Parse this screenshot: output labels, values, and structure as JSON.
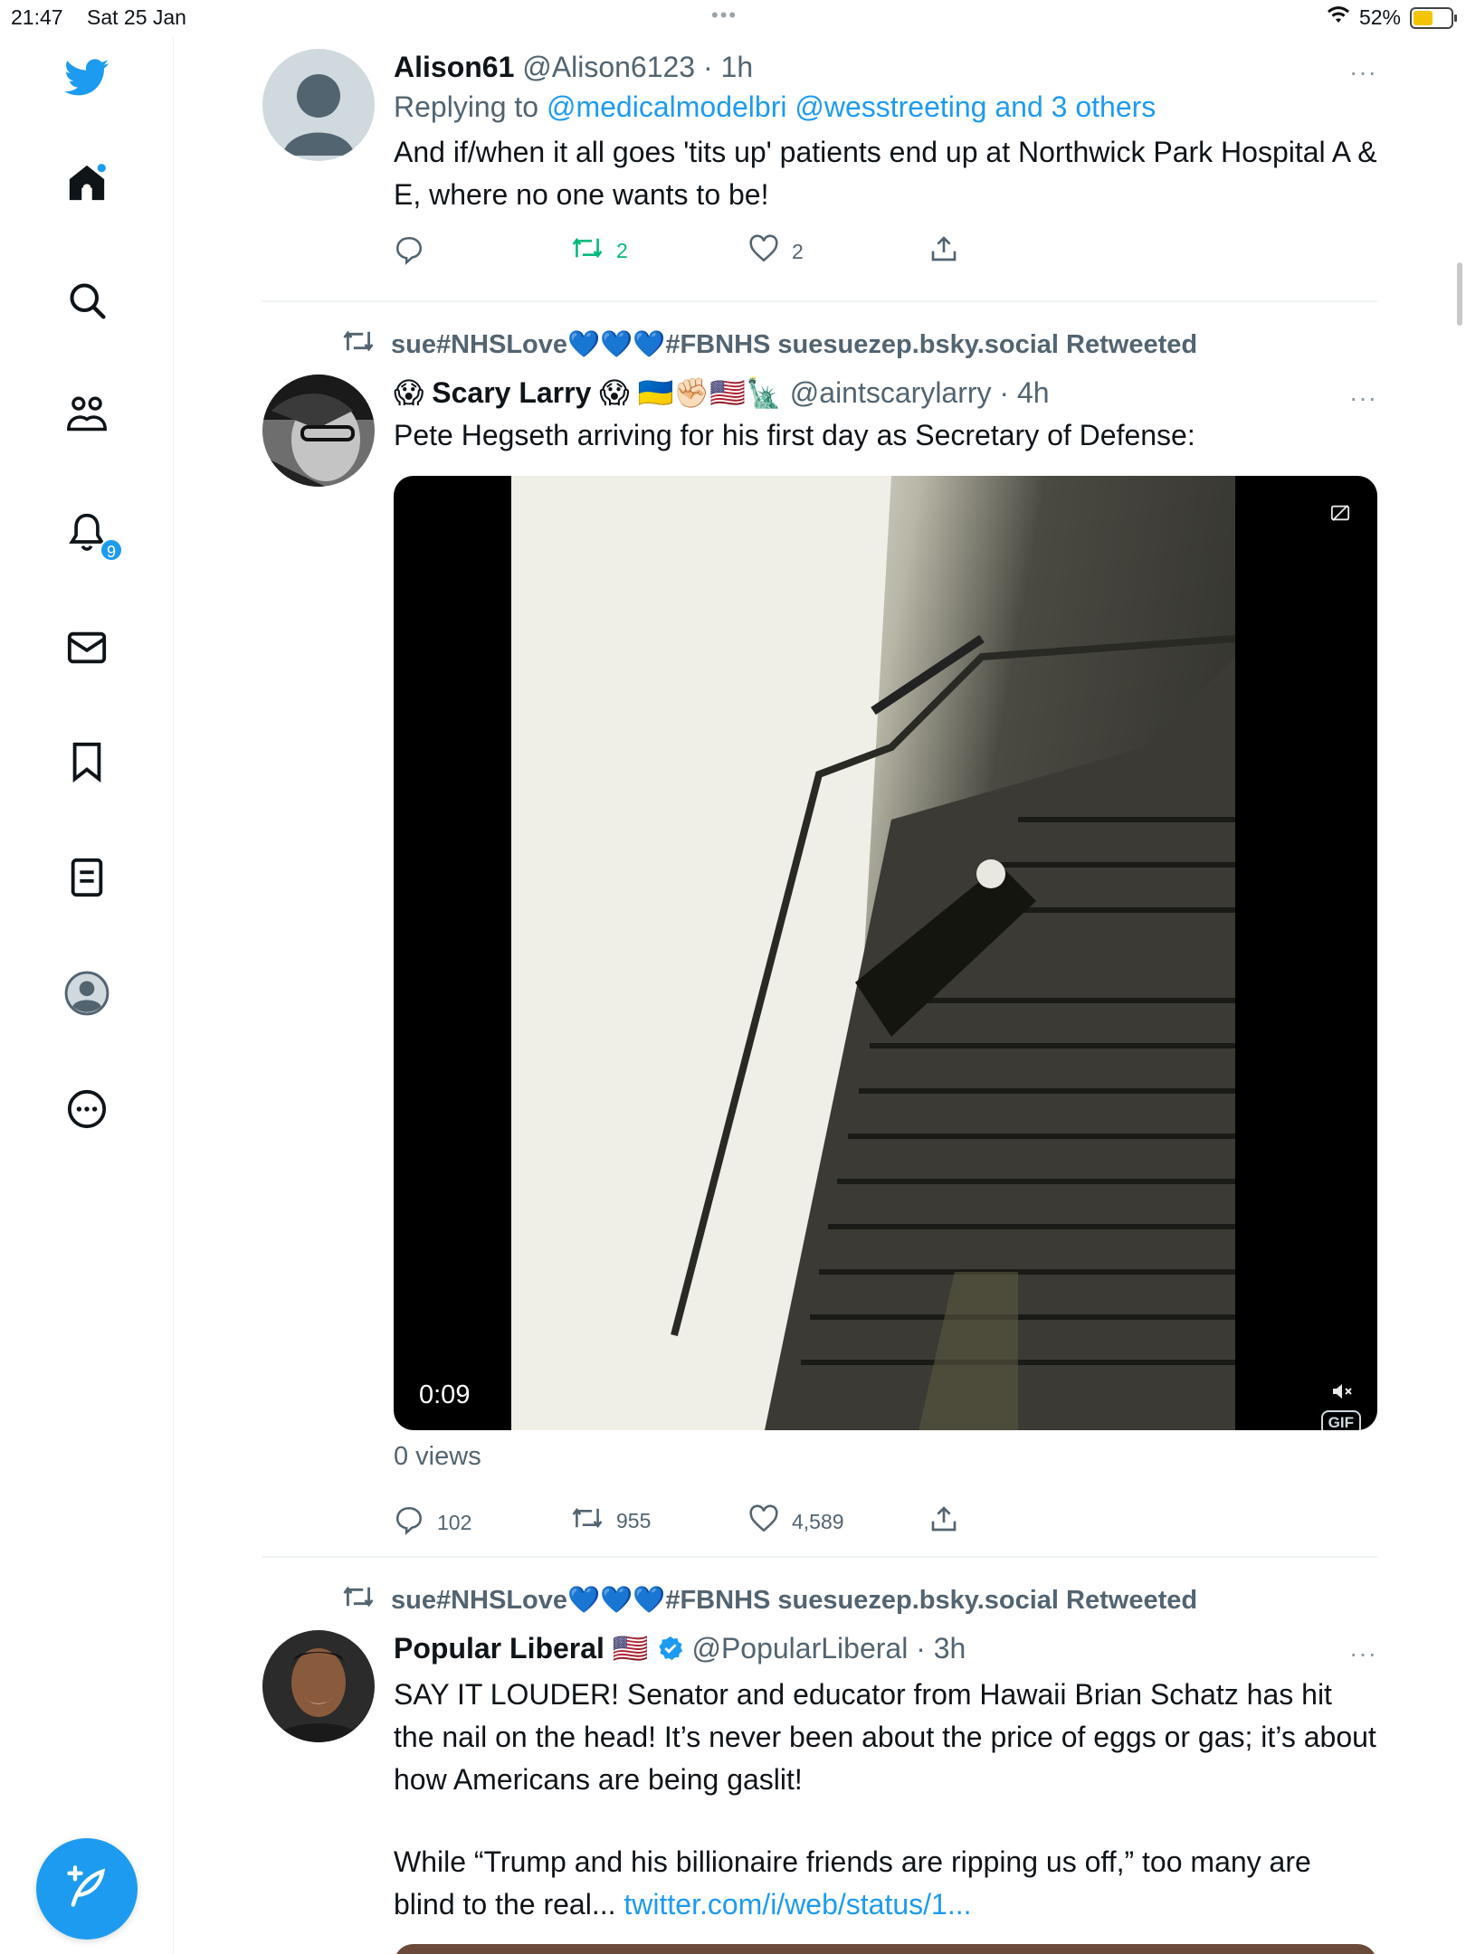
{
  "status_bar": {
    "time": "21:47",
    "date": "Sat 25 Jan",
    "battery_percent": "52%",
    "battery_level": 0.52,
    "wifi_icon": "wifi-icon"
  },
  "sidebar": {
    "items": [
      {
        "icon": "twitter-logo-icon"
      },
      {
        "icon": "home-icon"
      },
      {
        "icon": "search-icon"
      },
      {
        "icon": "communities-icon"
      },
      {
        "icon": "notifications-bell-icon",
        "badge": "9"
      },
      {
        "icon": "messages-envelope-icon"
      },
      {
        "icon": "bookmark-icon"
      },
      {
        "icon": "lists-icon"
      },
      {
        "icon": "profile-avatar-icon"
      },
      {
        "icon": "more-circle-icon"
      }
    ],
    "compose_icon": "compose-tweet-icon"
  },
  "tweets": [
    {
      "name": "Alison61",
      "handle": "@Alison6123",
      "time": "· 1h",
      "reply_prefix": "Replying to ",
      "reply_targets": "@medicalmodelbri @wesstreeting and 3 others",
      "text": "And if/when it all goes 'tits up' patients end up at Northwick Park Hospital A & E, where no one wants to be!",
      "replies": "",
      "retweets": "2",
      "likes": "2",
      "accent": "#00ba7c"
    },
    {
      "retweeted_by": "sue#NHSLove💙💙💙#FBNHS suesuezep.bsky.social Retweeted",
      "name_prefix": "😱",
      "name": "Scary Larry",
      "name_suffix": "😱 🇺🇦✊🏻🇺🇸🗽",
      "handle": "@aintscarylarry",
      "time": "· 4h",
      "text": "Pete Hegseth arriving for his first day as Secretary of Defense:",
      "media_time": "0:09",
      "media_badge": "GIF",
      "views": "0 views",
      "replies": "102",
      "retweets": "955",
      "likes": "4,589"
    },
    {
      "retweeted_by": "sue#NHSLove💙💙💙#FBNHS suesuezep.bsky.social Retweeted",
      "name": "Popular Liberal",
      "name_suffix": "🇺🇸",
      "handle": "@PopularLiberal",
      "time": "· 3h",
      "text_p1": "SAY IT LOUDER! Senator and educator from Hawaii Brian Schatz has hit the nail on the head! It’s never been about the price of eggs or gas; it’s about how Americans are being gaslit!",
      "text_p2": "While “Trump and his billionaire friends are ripping us off,” too many are blind to the real... ",
      "text_link": "twitter.com/i/web/status/1..."
    }
  ],
  "more_label": "···",
  "top_dots": "•••"
}
